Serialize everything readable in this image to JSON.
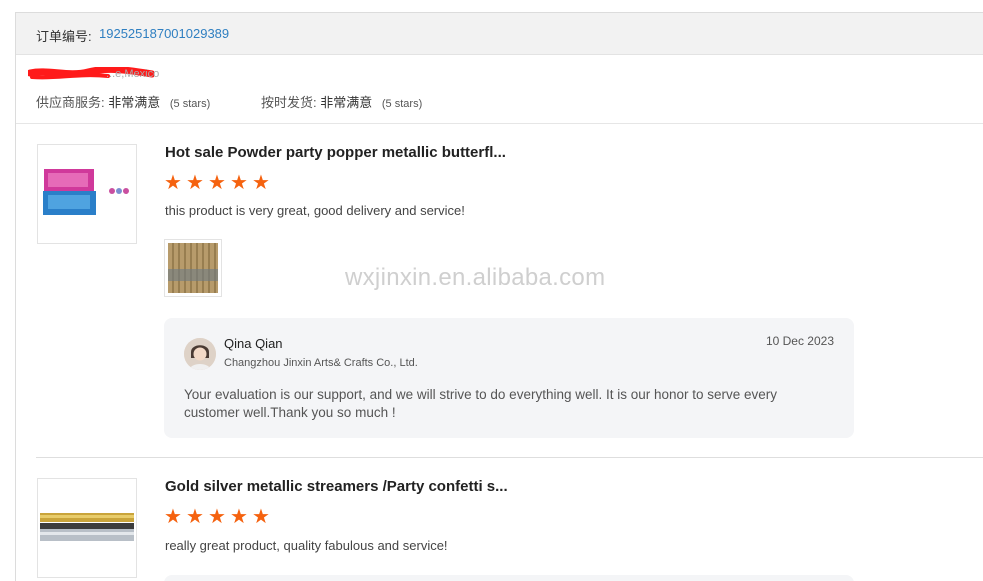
{
  "order": {
    "label": "订单编号:",
    "number": "192525187001029389"
  },
  "buyer": {
    "location": "...e,Mexico"
  },
  "ratings": [
    {
      "label": "供应商服务:",
      "value": "非常满意",
      "stars_text": "(5 stars)"
    },
    {
      "label": "按时发货:",
      "value": "非常满意",
      "stars_text": "(5 stars)"
    }
  ],
  "products": [
    {
      "title": "Hot sale Powder party popper metallic butterfl...",
      "rating": 5,
      "comment": "this product is very great, good delivery and service!"
    },
    {
      "title": "Gold silver metallic streamers /Party confetti s...",
      "rating": 5,
      "comment": "really great product, quality fabulous and service!"
    }
  ],
  "reply": {
    "name": "Qina Qian",
    "company": "Changzhou Jinxin Arts& Crafts Co., Ltd.",
    "date": "10 Dec 2023",
    "text": "Your evaluation is our support, and we will strive to do everything well. It is our honor to serve every customer well.Thank you so much !"
  },
  "watermark": "wxjinxin.en.alibaba.com",
  "icons": {
    "star": "star-icon",
    "avatar": "avatar-icon"
  },
  "colors": {
    "accent_link": "#2f7fc1",
    "star": "#f5620f",
    "reply_bg": "#f4f5f7"
  }
}
